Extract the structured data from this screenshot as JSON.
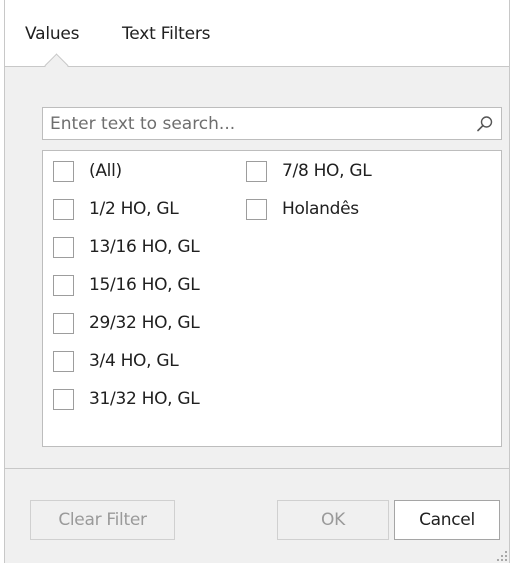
{
  "tabs": [
    {
      "label": "Values"
    },
    {
      "label": "Text Filters"
    }
  ],
  "search": {
    "value": "",
    "placeholder": "Enter text to search...",
    "icon": "search-icon"
  },
  "items": [
    {
      "label": "(All)",
      "checked": false
    },
    {
      "label": "1/2 HO, GL",
      "checked": false
    },
    {
      "label": "13/16 HO, GL",
      "checked": false
    },
    {
      "label": "15/16 HO, GL",
      "checked": false
    },
    {
      "label": "29/32 HO, GL",
      "checked": false
    },
    {
      "label": "3/4 HO, GL",
      "checked": false
    },
    {
      "label": "31/32 HO, GL",
      "checked": false
    },
    {
      "label": "7/8 HO, GL",
      "checked": false
    },
    {
      "label": "Holandês",
      "checked": false
    }
  ],
  "buttons": {
    "clear_filter": "Clear Filter",
    "ok": "OK",
    "cancel": "Cancel"
  },
  "colors": {
    "background": "#f0f0f0",
    "border": "#c8c8c8",
    "disabled_text": "#9a9a9a"
  }
}
